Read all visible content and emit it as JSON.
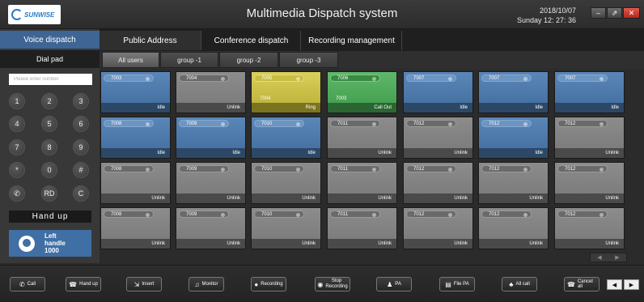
{
  "header": {
    "logo_text": "SUNWISE",
    "title": "Multimedia  Dispatch system",
    "date": "2018/10/07",
    "time": "Sunday  12: 27: 36",
    "window_buttons": [
      "–",
      "⇗",
      "✕"
    ]
  },
  "left": {
    "voice_dispatch": "Voice dispatch",
    "dial_pad": "Dial pad",
    "input_placeholder": "Please enter number",
    "keys": [
      "1",
      "2",
      "3",
      "4",
      "5",
      "6",
      "7",
      "8",
      "9",
      "*",
      "0",
      "#",
      "call-icon",
      "RD",
      "C"
    ],
    "hand_up": "Hand up",
    "left_handle_line1": "Left",
    "left_handle_line2": "handle",
    "left_handle_line3": "1000"
  },
  "top_tabs": [
    "Public Address",
    "Conference dispatch",
    "Recording management"
  ],
  "group_tabs": [
    "All users",
    "group -1",
    "group -2",
    "group -3"
  ],
  "tiles": [
    {
      "ext": "7003",
      "sub": "",
      "status": "Idle",
      "state": "idle"
    },
    {
      "ext": "7004",
      "sub": "",
      "status": "Unlink",
      "state": "unlink"
    },
    {
      "ext": "7005",
      "sub": "7004",
      "status": "Ring",
      "state": "ring"
    },
    {
      "ext": "7006",
      "sub": "7003",
      "status": "Call Out",
      "state": "callout"
    },
    {
      "ext": "7007",
      "sub": "",
      "status": "Idle",
      "state": "idle"
    },
    {
      "ext": "7007",
      "sub": "",
      "status": "Idle",
      "state": "idle"
    },
    {
      "ext": "7007",
      "sub": "",
      "status": "Idle",
      "state": "idle"
    },
    {
      "ext": "7008",
      "sub": "",
      "status": "Idle",
      "state": "idle"
    },
    {
      "ext": "7009",
      "sub": "",
      "status": "Idle",
      "state": "idle"
    },
    {
      "ext": "7010",
      "sub": "",
      "status": "Idle",
      "state": "idle"
    },
    {
      "ext": "7011",
      "sub": "",
      "status": "Unlink",
      "state": "unlink"
    },
    {
      "ext": "7012",
      "sub": "",
      "status": "Unlink",
      "state": "unlink"
    },
    {
      "ext": "7012",
      "sub": "",
      "status": "Idle",
      "state": "idle"
    },
    {
      "ext": "7012",
      "sub": "",
      "status": "Unlink",
      "state": "unlink"
    },
    {
      "ext": "7008",
      "sub": "",
      "status": "Unlink",
      "state": "unlink"
    },
    {
      "ext": "7009",
      "sub": "",
      "status": "Unlink",
      "state": "unlink"
    },
    {
      "ext": "7010",
      "sub": "",
      "status": "Unlink",
      "state": "unlink"
    },
    {
      "ext": "7011",
      "sub": "",
      "status": "Unlink",
      "state": "unlink"
    },
    {
      "ext": "7012",
      "sub": "",
      "status": "Unlink",
      "state": "unlink"
    },
    {
      "ext": "7012",
      "sub": "",
      "status": "Unlink",
      "state": "unlink"
    },
    {
      "ext": "7012",
      "sub": "",
      "status": "Unlink",
      "state": "unlink"
    },
    {
      "ext": "7008",
      "sub": "",
      "status": "Unlink",
      "state": "unlink"
    },
    {
      "ext": "7009",
      "sub": "",
      "status": "Unlink",
      "state": "unlink"
    },
    {
      "ext": "7010",
      "sub": "",
      "status": "Unlink",
      "state": "unlink"
    },
    {
      "ext": "7011",
      "sub": "",
      "status": "Unlink",
      "state": "unlink"
    },
    {
      "ext": "7012",
      "sub": "",
      "status": "Unlink",
      "state": "unlink"
    },
    {
      "ext": "7012",
      "sub": "",
      "status": "Unlink",
      "state": "unlink"
    },
    {
      "ext": "7012",
      "sub": "",
      "status": "Unlink",
      "state": "unlink"
    }
  ],
  "pager": [
    "◀",
    "▶"
  ],
  "toolbar": [
    {
      "label": "Call",
      "icon": "phone-icon",
      "glyph": "✆"
    },
    {
      "label": "Hand up",
      "icon": "hangup-icon",
      "glyph": "☎"
    },
    {
      "label": "Insert",
      "icon": "insert-icon",
      "glyph": "⇲"
    },
    {
      "label": "Monitor",
      "icon": "headphones-icon",
      "glyph": "♫"
    },
    {
      "label": "Recording",
      "icon": "microphone-icon",
      "glyph": "●"
    },
    {
      "label": "Stop Recording",
      "icon": "stop-icon",
      "glyph": "◉"
    },
    {
      "label": "PA",
      "icon": "person-icon",
      "glyph": "♟"
    },
    {
      "label": "File PA",
      "icon": "file-icon",
      "glyph": "▤"
    },
    {
      "label": "All call",
      "icon": "group-icon",
      "glyph": "♣"
    },
    {
      "label": "Cancel all",
      "icon": "cancel-icon",
      "glyph": "☎"
    }
  ],
  "nav": [
    "◀",
    "▶"
  ],
  "colors": {
    "idle": "#4a78aa",
    "unlink": "#808080",
    "ring": "#cfc54c",
    "call_out": "#4fa85a",
    "accent": "#3e6593"
  }
}
